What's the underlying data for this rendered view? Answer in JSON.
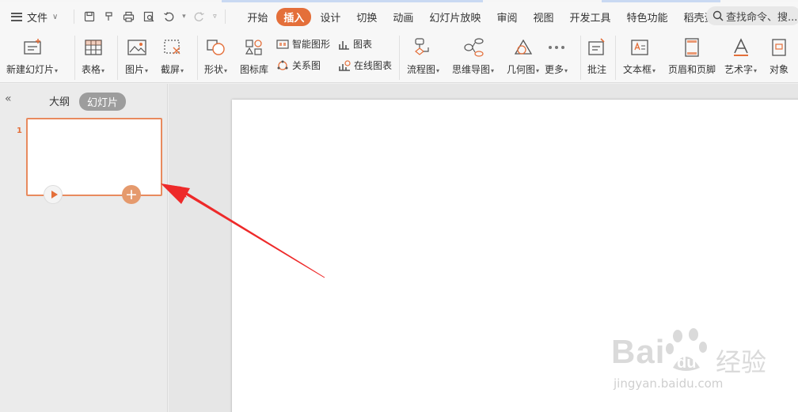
{
  "app": {
    "file_menu": "文件",
    "menu_tabs": [
      "开始",
      "插入",
      "设计",
      "切换",
      "动画",
      "幻灯片放映",
      "审阅",
      "视图",
      "开发工具",
      "特色功能",
      "稻壳资源"
    ],
    "active_tab": "插入",
    "search_placeholder": "查找命令、搜..."
  },
  "ribbon": {
    "new_slide": "新建幻灯片",
    "table": "表格",
    "picture": "图片",
    "screenshot": "截屏",
    "shape": "形状",
    "icon_lib": "图标库",
    "smart_art": "智能图形",
    "chart": "图表",
    "relation": "关系图",
    "online_chart": "在线图表",
    "flowchart": "流程图",
    "mindmap": "思维导图",
    "geometry": "几何图",
    "more": "更多",
    "comment": "批注",
    "textbox": "文本框",
    "header_footer": "页眉和页脚",
    "wordart": "艺术字",
    "object": "对象"
  },
  "panel": {
    "outline_tab": "大纲",
    "slides_tab": "幻灯片",
    "slide_number": "1"
  },
  "watermark": {
    "brand": "Bai",
    "brand2": "du",
    "cn": "经验",
    "url": "jingyan.baidu.com"
  },
  "colors": {
    "accent": "#e46f3a",
    "arrow": "#ee2a2a"
  }
}
